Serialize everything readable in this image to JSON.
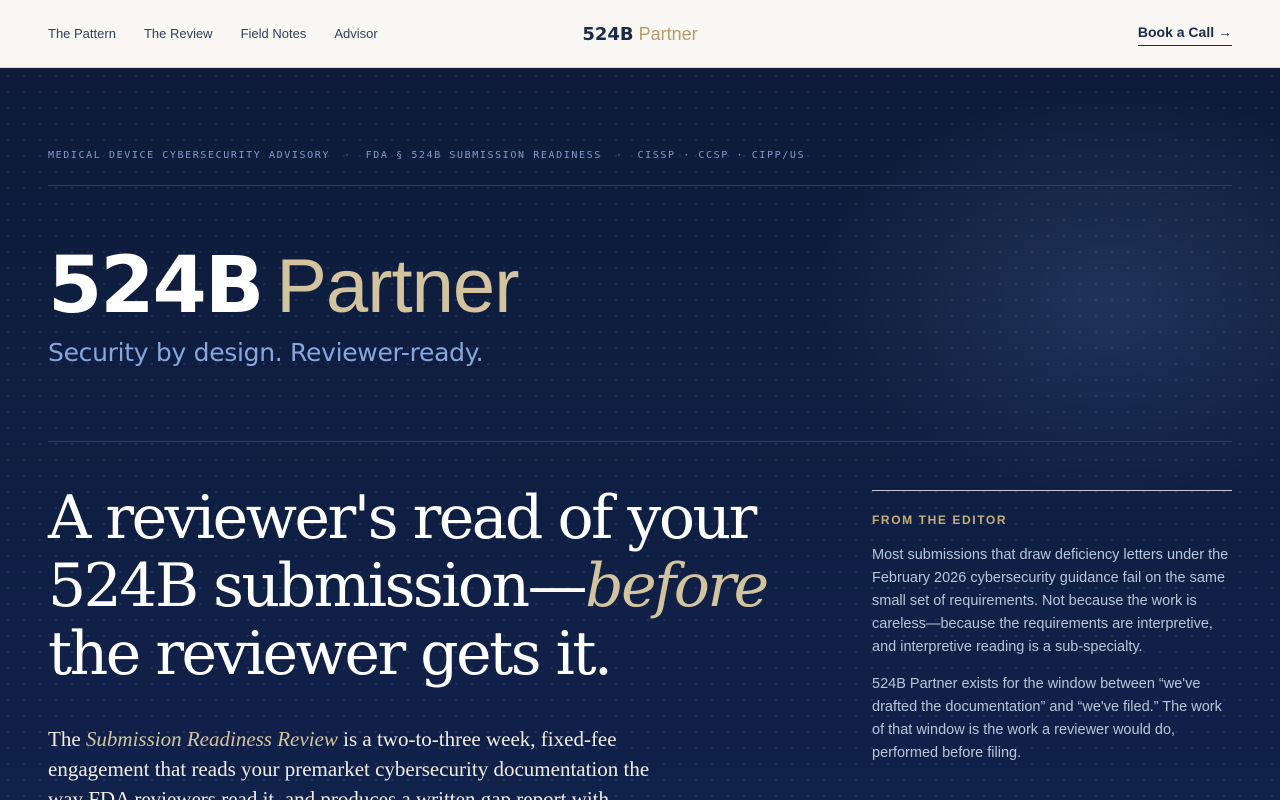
{
  "nav": {
    "links": [
      "The Pattern",
      "The Review",
      "Field Notes",
      "Advisor"
    ],
    "brand_bold": "524B",
    "brand_light": "Partner",
    "cta_label": "Book a Call →"
  },
  "hero": {
    "eyebrow": [
      "MEDICAL DEVICE CYBERSECURITY ADVISORY",
      "FDA § 524B SUBMISSION READINESS",
      "CISSP · CCSP · CIPP/US"
    ],
    "eyebrow_separator": "·",
    "mark_bold": "524B",
    "mark_light": "Partner",
    "tagline": "Security by design. Reviewer-ready.",
    "headline_line1": "A reviewer's read of your",
    "headline_line2_pre": "524B submission—",
    "headline_emphasis": "before",
    "headline_line3": "the reviewer gets it.",
    "intro_pre": "The",
    "intro_emphasis": "Submission Readiness Review",
    "intro_post": "is a two-to-three week, fixed-fee engagement that reads your premarket cybersecurity documentation the way FDA reviewers read it, and produces a written gap report with"
  },
  "editor": {
    "label": "FROM THE EDITOR",
    "paragraphs": [
      "Most submissions that draw deficiency letters under the February 2026 cybersecurity guidance fail on the same small set of requirements. Not because the work is careless—because the requirements are interpretive, and interpretive reading is a sub-specialty.",
      "524B Partner exists for the window between “we've drafted the documentation” and “we've filed.” The work of that window is the work a reviewer would do, performed before filing."
    ]
  },
  "colors": {
    "background": "#0f1f3f",
    "accent_gold": "#d3c39e",
    "tagline_blue": "#86a6dc",
    "nav_bg": "#f8f7f3"
  }
}
